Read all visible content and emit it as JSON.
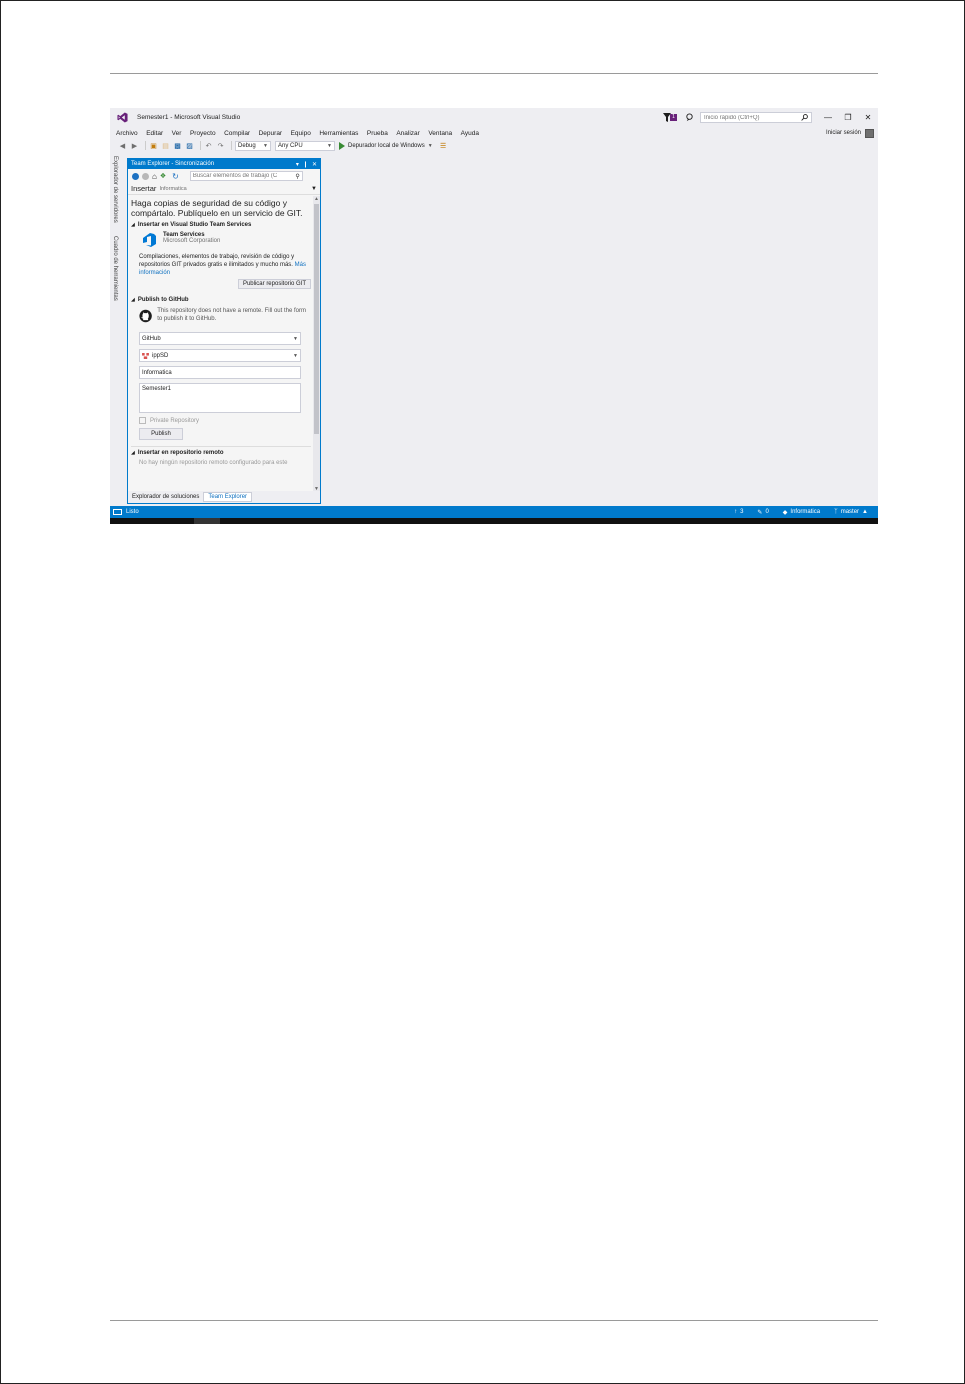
{
  "window": {
    "title": "Semester1 - Microsoft Visual Studio",
    "notification_count": "1",
    "quick_launch_placeholder": "Inicio rápido (Ctrl+Q)",
    "sign_in_label": "Iniciar sesión"
  },
  "menu": [
    "Archivo",
    "Editar",
    "Ver",
    "Proyecto",
    "Compilar",
    "Depurar",
    "Equipo",
    "Herramientas",
    "Prueba",
    "Analizar",
    "Ventana",
    "Ayuda"
  ],
  "toolbar": {
    "config_value": "Debug",
    "platform_value": "Any CPU",
    "start_label": "Depurador local de Windows"
  },
  "side_tabs": {
    "server_explorer": "Explorador de servidores",
    "toolbox": "Cuadro de herramientas"
  },
  "team_explorer": {
    "header_title": "Team Explorer - Sincronización",
    "search_placeholder": "Buscar elementos de trabajo (C",
    "nav_title": "Insertar",
    "nav_subtitle": "Informatica",
    "headline": "Haga copias de seguridad de su código y compártalo. Publíquelo en un servicio de GIT.",
    "vsts": {
      "section_title": "Insertar en Visual Studio Team Services",
      "service_name": "Team Services",
      "service_corp": "Microsoft Corporation",
      "description": "Compilaciones, elementos de trabajo, revisión de código y repositorios GIT privados gratis e ilimitados y mucho más.",
      "more_info_link": "Más información",
      "publish_button": "Publicar repositorio GIT"
    },
    "github": {
      "section_title": "Publish to GitHub",
      "description": "This repository does not have a remote. Fill out the form to publish it to GitHub.",
      "host_value": "GitHub",
      "owner_value": "ippSD",
      "repo_name_value": "Informatica",
      "description_value": "Semester1",
      "private_label": "Private Repository",
      "publish_button": "Publish"
    },
    "remote": {
      "section_title": "Insertar en repositorio remoto",
      "note": "No hay ningún repositorio remoto configurado para este"
    },
    "bottom_tabs": [
      "Explorador de soluciones",
      "Team Explorer"
    ]
  },
  "statusbar": {
    "ready": "Listo",
    "commits_ahead": "3",
    "pending_changes": "0",
    "repo": "Informatica",
    "branch": "master"
  },
  "colors": {
    "accent": "#007acc",
    "vs_purple": "#68217a",
    "link": "#0e70c0",
    "run_green": "#388a34"
  }
}
